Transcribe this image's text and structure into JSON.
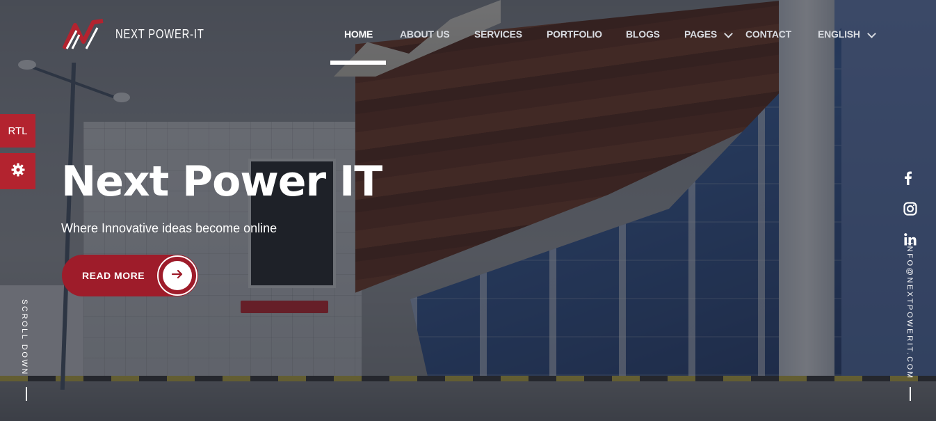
{
  "brand": {
    "name": "NEXT POWER-IT",
    "logo_color": "#b3232f"
  },
  "nav": {
    "items": [
      {
        "label": "HOME",
        "active": true
      },
      {
        "label": "ABOUT US"
      },
      {
        "label": "SERVICES"
      },
      {
        "label": "PORTFOLIO"
      },
      {
        "label": "BLOGS"
      },
      {
        "label": "PAGES",
        "has_dropdown": true
      },
      {
        "label": "CONTACT"
      }
    ],
    "language": "ENGLISH"
  },
  "side": {
    "rtl_label": "RTL",
    "settings_icon": "gear-icon"
  },
  "hero": {
    "title": "Next Power IT",
    "subtitle": "Where Innovative ideas become online",
    "cta_label": "READ MORE",
    "cta_icon": "arrow-right-icon"
  },
  "scroll_label": "SCROLL DOWN",
  "email": "INFO@NEXTPOWERIT.COM",
  "social": [
    "facebook-icon",
    "instagram-icon",
    "linkedin-icon"
  ],
  "colors": {
    "accent": "#b3232f",
    "button": "#9e1c2a"
  }
}
